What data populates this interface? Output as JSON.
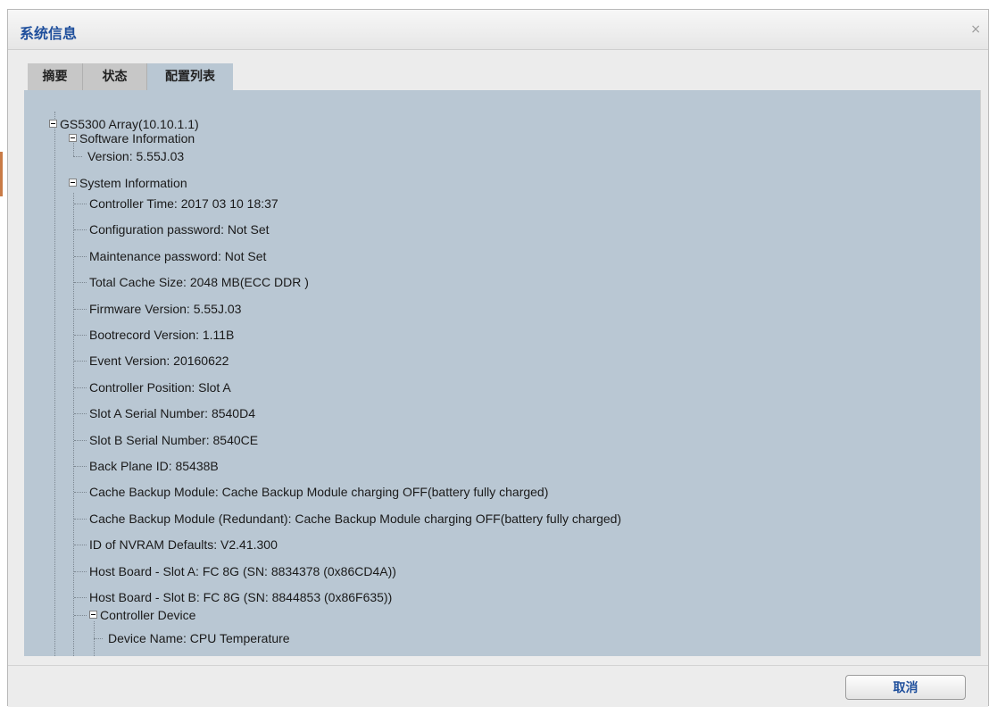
{
  "dialog": {
    "title": "系统信息",
    "close_label": "×"
  },
  "tabs": [
    {
      "label": "摘要"
    },
    {
      "label": "状态"
    },
    {
      "label": "配置列表",
      "active": true
    }
  ],
  "tree": {
    "root": "GS5300 Array(10.10.1.1)",
    "software": {
      "label": "Software Information",
      "items": [
        "Version: 5.55J.03"
      ]
    },
    "system": {
      "label": "System Information",
      "items": [
        "Controller Time: 2017 03 10 18:37",
        "Configuration password: Not Set",
        "Maintenance password: Not Set",
        "Total Cache Size: 2048 MB(ECC DDR )",
        "Firmware Version: 5.55J.03",
        "Bootrecord Version: 1.11B",
        "Event Version: 20160622",
        "Controller Position: Slot A",
        "Slot A Serial Number: 8540D4",
        "Slot B Serial Number: 8540CE",
        "Back Plane ID: 85438B",
        "Cache Backup Module: Cache Backup Module charging OFF(battery fully charged)",
        "Cache Backup Module (Redundant): Cache Backup Module charging OFF(battery fully charged)",
        "ID of NVRAM Defaults: V2.41.300",
        "Host Board - Slot A: FC 8G (SN: 8834378 (0x86CD4A))",
        "Host Board - Slot B: FC 8G (SN: 8844853 (0x86F635))"
      ],
      "controller_device": {
        "label": "Controller Device",
        "items": [
          "Device Name: CPU Temperature"
        ]
      }
    }
  },
  "footer": {
    "cancel_label": "取消"
  },
  "colors": {
    "panel": "#b9c7d3",
    "title": "#1f4f9c",
    "active_tab": "#b9c7d3"
  }
}
